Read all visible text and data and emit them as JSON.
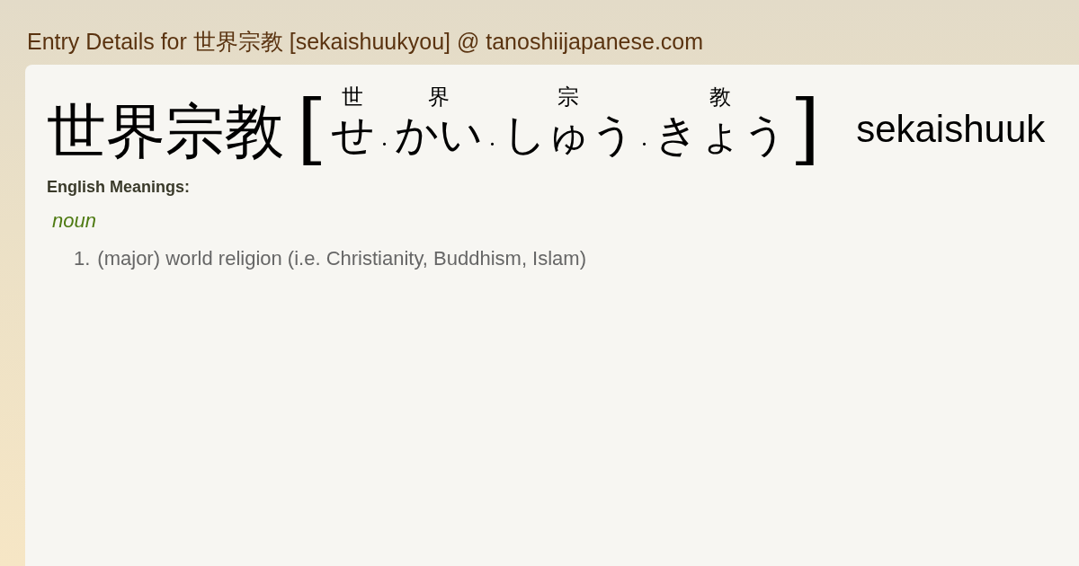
{
  "page_title": "Entry Details for 世界宗教 [sekaishuukyou] @ tanoshiijapanese.com",
  "entry": {
    "headword": "世界宗教",
    "open_bracket": "[",
    "close_bracket": "]",
    "separator": "·",
    "romaji": "sekaishuuk",
    "readings": [
      {
        "kanji": "世",
        "kana": "せ"
      },
      {
        "kanji": "界",
        "kana": "かい"
      },
      {
        "kanji": "宗",
        "kana": "しゅう"
      },
      {
        "kanji": "教",
        "kana": "きょう"
      }
    ]
  },
  "meanings": {
    "heading": "English Meanings:",
    "part_of_speech": "noun",
    "senses": [
      {
        "number": "1.",
        "text": "(major) world religion (i.e. Christianity, Buddhism, Islam)"
      }
    ]
  }
}
